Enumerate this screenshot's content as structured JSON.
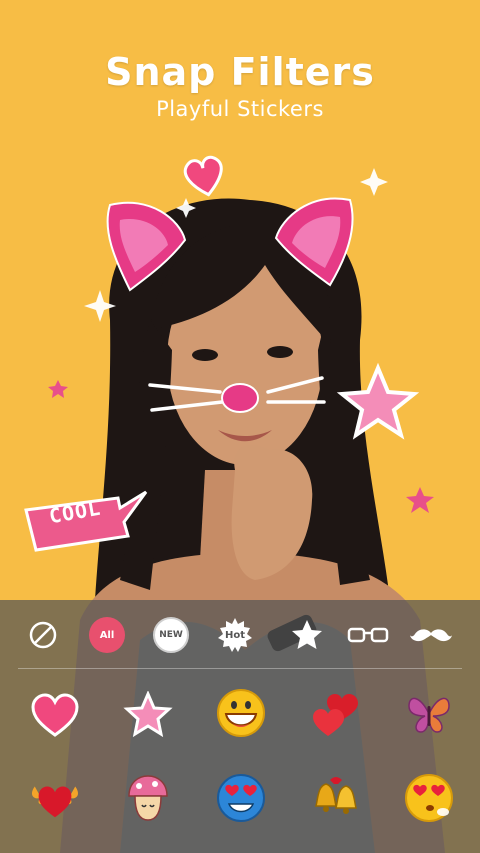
{
  "header": {
    "title": "Snap Filters",
    "subtitle": "Playful Stickers"
  },
  "overlay": {
    "cool_sticker_text": "COOL"
  },
  "categories": [
    {
      "id": "none",
      "label": "",
      "icon": "prohibited-icon"
    },
    {
      "id": "all",
      "label": "All",
      "selected": true
    },
    {
      "id": "new",
      "label": "NEW"
    },
    {
      "id": "hot",
      "label": "Hot"
    },
    {
      "id": "star",
      "label": "",
      "icon": "star-icon"
    },
    {
      "id": "glasses",
      "label": "",
      "icon": "glasses-icon"
    },
    {
      "id": "mustache",
      "label": "",
      "icon": "mustache-icon"
    }
  ],
  "stickers": [
    {
      "icon": "heart-icon"
    },
    {
      "icon": "star-icon"
    },
    {
      "icon": "grinning-face-icon"
    },
    {
      "icon": "double-heart-icon"
    },
    {
      "icon": "butterfly-icon"
    },
    {
      "icon": "winged-heart-icon"
    },
    {
      "icon": "mushroom-icon"
    },
    {
      "icon": "heart-eyes-face-icon"
    },
    {
      "icon": "bells-icon"
    },
    {
      "icon": "kiss-face-icon"
    }
  ],
  "colors": {
    "background": "#F7BD45",
    "accent": "#E8506E",
    "sticker_pink": "#F0487E"
  }
}
